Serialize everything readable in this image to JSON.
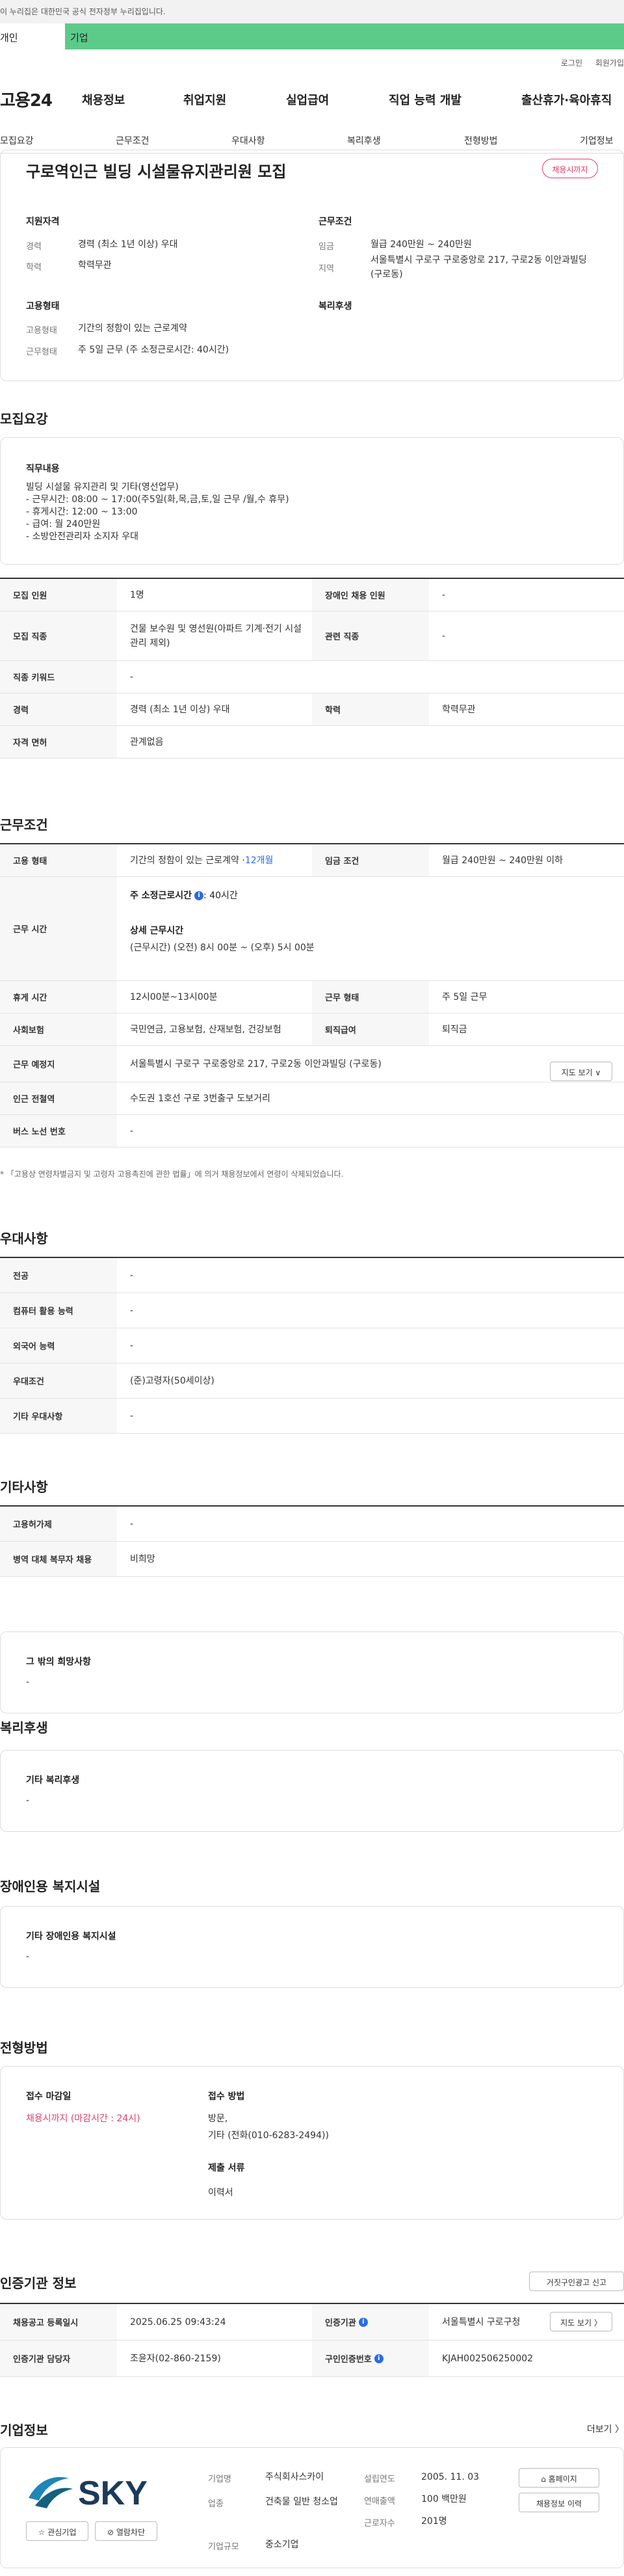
{
  "gov_bar": "이 누리집은 대한민국 공식 전자정부 누리집입니다.",
  "top_tabs": {
    "person": "개인",
    "company": "기업"
  },
  "util": {
    "login": "로그인",
    "join": "회원가입"
  },
  "brand": "고용24",
  "gnb": [
    "채용정보",
    "취업지원",
    "실업급여",
    "직업 능력 개발",
    "출산휴가·육아휴직"
  ],
  "subnav": [
    "모집요강",
    "근무조건",
    "우대사항",
    "복리후생",
    "전형방법",
    "기업정보"
  ],
  "summary": {
    "title": "구로역인근 빌딩 시설물유지관리원 모집",
    "badge": "채용시까지",
    "qual_label": "지원자격",
    "career_k": "경력",
    "career_v": "경력 (최소 1년 이상) 우대",
    "edu_k": "학력",
    "edu_v": "학력무관",
    "cond_label": "근무조건",
    "wage_k": "임금",
    "wage_v": "월급 240만원 ~ 240만원",
    "area_k": "지역",
    "area_v": "서울특별시 구로구 구로중앙로 217, 구로2동 이안과빌딩 (구로동)",
    "emp_label": "고용형태",
    "emptype_k": "고용형태",
    "emptype_v": "기간의 정함이 있는 근로계약",
    "worktype_k": "근무형태",
    "worktype_v": "주 5일 근무 (주 소정근로시간: 40시간)",
    "welfare_label": "복리후생"
  },
  "recruit": {
    "heading": "모집요강",
    "duty_title": "직무내용",
    "duty_text": "빌딩 시설물 유지관리 및 기타(영선업무)\n- 근무시간: 08:00 ~ 17:00(주5일(화,목,금,토,일 근무 /월,수 휴무)\n- 휴게시간: 12:00 ~ 13:00\n- 급여: 월 240만원\n- 소방안전관리자 소지자 우대",
    "rows": {
      "count_k": "모집 인원",
      "count_v": "1명",
      "disabled_k": "장애인 채용 인원",
      "disabled_v": "-",
      "job_k": "모집 직종",
      "job_v": "건물 보수원 및 영선원(아파트 기계·전기 시설관리 제외)",
      "related_k": "관련 직종",
      "related_v": "-",
      "keyword_k": "직종 키워드",
      "keyword_v": "-",
      "career_k": "경력",
      "career_v": "경력 (최소 1년 이상) 우대",
      "edu_k": "학력",
      "edu_v": "학력무관",
      "license_k": "자격 면허",
      "license_v": "관계없음"
    }
  },
  "work": {
    "heading": "근무조건",
    "emptype_k": "고용 형태",
    "emptype_v": "기간의 정함이 있는 근로계약 · ",
    "emptype_months": "12개월",
    "wage_k": "임금 조건",
    "wage_v": "월급 240만원 ~ 240만원 이하",
    "hours_k": "근무 시간",
    "weekly_label": "주 소정근로시간",
    "weekly_v": ": 40시간",
    "detail_label": "상세 근무시간",
    "detail_v": "(근무시간) (오전) 8시 00분 ~ (오후) 5시 00분",
    "break_k": "휴게 시간",
    "break_v": "12시00분~13시00분",
    "form_k": "근무 형태",
    "form_v": "주 5일 근무",
    "insurance_k": "사회보험",
    "insurance_v": "국민연금, 고용보험, 산재보험, 건강보험",
    "retire_k": "퇴직급여",
    "retire_v": "퇴직금",
    "place_k": "근무 예정지",
    "place_v": "서울특별시 구로구 구로중앙로 217, 구로2동 이안과빌딩 (구로동)",
    "map_btn": "지도 보기 ∨",
    "subway_k": "인근 전철역",
    "subway_v": "수도권 1호선 구로 3번출구 도보거리",
    "bus_k": "버스 노선 번호",
    "bus_v": "-",
    "note": "* 「고용상 연령차별금지 및 고령자 고용촉진에 관한 법률」에 의거 채용정보에서 연령이 삭제되었습니다."
  },
  "pref": {
    "heading": "우대사항",
    "major_k": "전공",
    "major_v": "-",
    "computer_k": "컴퓨터 활용 능력",
    "computer_v": "-",
    "lang_k": "외국어 능력",
    "lang_v": "-",
    "cond_k": "우대조건",
    "cond_v": "(준)고령자(50세이상)",
    "etc_k": "기타 우대사항",
    "etc_v": "-"
  },
  "other": {
    "heading": "기타사항",
    "permit_k": "고용허가제",
    "permit_v": "-",
    "military_k": "병역 대체 복무자 채용",
    "military_v": "비희망",
    "wish_title": "그 밖의 희망사항",
    "wish_v": "-"
  },
  "welfare": {
    "heading": "복리후생",
    "title": "기타 복리후생",
    "value": "-"
  },
  "disabled": {
    "heading": "장애인용 복지시설",
    "title": "기타 장애인용 복지시설",
    "value": "-"
  },
  "selection": {
    "heading": "전형방법",
    "deadline_title": "접수 마감일",
    "deadline_v": "채용시까지 (마감시간 : 24시)",
    "method_title": "접수 방법",
    "method_v1": "방문,",
    "method_v2": "기타 (전화(010-6283-2494))",
    "docs_title": "제출 서류",
    "docs_v": "이력서"
  },
  "cert": {
    "heading": "인증기관 정보",
    "report_btn": "거짓구인광고 신고",
    "regdate_k": "채용공고 등록일시",
    "regdate_v": "2025.06.25 09:43:24",
    "agency_k": "인증기관",
    "agency_v": "서울특별시 구로구청",
    "map_btn": "지도 보기 〉",
    "manager_k": "인증기관 담당자",
    "manager_v": "조윤자(02-860-2159)",
    "authno_k": "구인인증번호",
    "authno_v": "KJAH002506250002"
  },
  "company": {
    "heading": "기업정보",
    "more": "더보기 〉",
    "logo_text": "SKY",
    "fav_btn": "☆ 관심기업",
    "block_btn": "⊘ 열람차단",
    "name_k": "기업명",
    "name_v": "주식회사스카이",
    "industry_k": "업종",
    "industry_v": "건축물 일반 청소업",
    "size_k": "기업규모",
    "size_v": "중소기업",
    "founded_k": "설립연도",
    "founded_v": "2005. 11. 03",
    "sales_k": "연매출액",
    "sales_v": "100 백만원",
    "staff_k": "근로자수",
    "staff_v": "201명",
    "home_btn": "홈페이지",
    "history_btn": "채용정보 이력"
  }
}
